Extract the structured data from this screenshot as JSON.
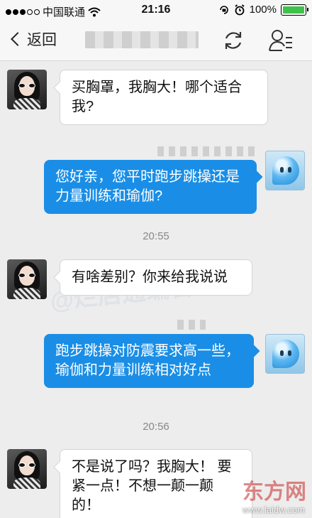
{
  "status_bar": {
    "carrier": "中国联通",
    "time": "21:16",
    "battery": "100%",
    "battery_color": "#3ec24b"
  },
  "nav": {
    "back_label": "返回",
    "sync_icon": "sync-icon",
    "profile_icon": "profile-menu-icon"
  },
  "messages": [
    {
      "side": "in",
      "text": "买胸罩，我胸大！哪个适合我?"
    },
    {
      "side": "out",
      "text": "您好亲，您平时跑步跳操还是力量训练和瑜伽?"
    },
    {
      "side": "in",
      "text": "有啥差别？你来给我说说"
    },
    {
      "side": "out",
      "text": "跑步跳操对防震要求高一些，瑜伽和力量训练相对好点"
    },
    {
      "side": "in",
      "text": "不是说了吗？我胸大！ 要紧一点！不想一颠一颠的！"
    }
  ],
  "timestamps": [
    "20:55",
    "20:56"
  ],
  "watermark": {
    "text": "@烂店通编台",
    "logo_text": "东方网",
    "url": "www.laidw.com"
  },
  "colors": {
    "outgoing_bubble": "#1a8ee6",
    "incoming_bubble": "#ffffff",
    "background": "#ededed"
  }
}
